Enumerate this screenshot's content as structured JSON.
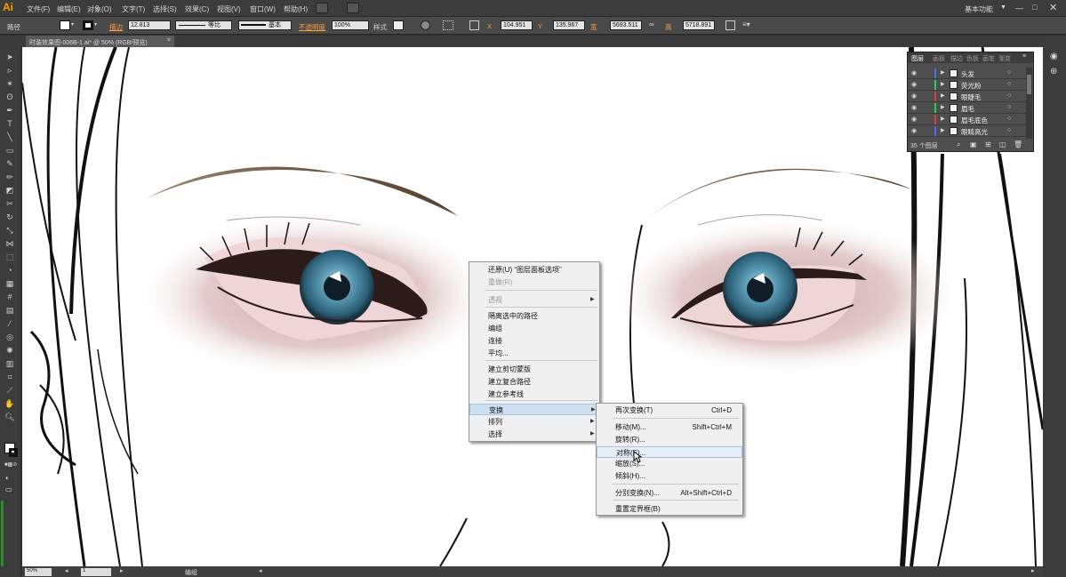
{
  "app": {
    "logo": "Ai",
    "workspace": "基本功能"
  },
  "menus": [
    "文件(F)",
    "编辑(E)",
    "对象(O)",
    "文字(T)",
    "选择(S)",
    "效果(C)",
    "视图(V)",
    "窗口(W)",
    "帮助(H)"
  ],
  "control": {
    "mode": "路径",
    "stroke_label": "描边",
    "stroke_weight": "12.813",
    "profile1": "等比",
    "profile2": "基本",
    "opacity_label": "不透明度",
    "opacity": "100%",
    "style_label": "样式",
    "x_label": "X",
    "x": "104.951",
    "y_label": "Y",
    "y": "135.967",
    "w_label": "宽",
    "w": "5693.511",
    "h_label": "高",
    "h": "5718.891"
  },
  "document": {
    "tab": "时装效果图-006B-1.ai* @ 50% (RGB/预览)",
    "zoom": "50%",
    "page": "1",
    "status": "编组"
  },
  "layers_panel": {
    "tabs": [
      "图层",
      "画板",
      "描边",
      "色板",
      "画笔",
      "渐变"
    ],
    "rows": [
      {
        "name": "头发",
        "color": "#4a6bff"
      },
      {
        "name": "荧光粉",
        "color": "#1fd64a"
      },
      {
        "name": "眼睫毛",
        "color": "#e23a3a"
      },
      {
        "name": "眉毛",
        "color": "#1fd64a"
      },
      {
        "name": "眉毛底色",
        "color": "#e23a3a"
      },
      {
        "name": "眼睛高光",
        "color": "#4a6bff"
      }
    ],
    "count": "35 个图层"
  },
  "context_menu": {
    "items": [
      {
        "label": "还原(U) “图层面板选项”",
        "disabled": false
      },
      {
        "label": "重做(R)",
        "disabled": true
      },
      {
        "label": "透视",
        "disabled": true,
        "submenu": true
      },
      {
        "label": "隔离选中的路径",
        "disabled": false
      },
      {
        "label": "编组",
        "disabled": false
      },
      {
        "label": "连接",
        "disabled": false
      },
      {
        "label": "平均...",
        "disabled": false
      },
      {
        "label": "建立剪切蒙版",
        "disabled": false
      },
      {
        "label": "建立复合路径",
        "disabled": false
      },
      {
        "label": "建立参考线",
        "disabled": false
      },
      {
        "label": "变换",
        "disabled": false,
        "submenu": true,
        "active": true
      },
      {
        "label": "排列",
        "disabled": false,
        "submenu": true
      },
      {
        "label": "选择",
        "disabled": false,
        "submenu": true
      }
    ]
  },
  "transform_submenu": {
    "items": [
      {
        "label": "再次变换(T)",
        "shortcut": "Ctrl+D"
      },
      {
        "label": "移动(M)...",
        "shortcut": "Shift+Ctrl+M"
      },
      {
        "label": "旋转(R)...",
        "shortcut": ""
      },
      {
        "label": "对称(E)...",
        "shortcut": "",
        "highlighted": true
      },
      {
        "label": "缩放(S)...",
        "shortcut": ""
      },
      {
        "label": "倾斜(H)...",
        "shortcut": ""
      },
      {
        "label": "分别变换(N)...",
        "shortcut": "Alt+Shift+Ctrl+D"
      },
      {
        "label": "重置定界框(B)",
        "shortcut": ""
      }
    ]
  },
  "colors": {
    "accent": "#ff9a00",
    "iris": "#3f7f99",
    "brow": "#6b5846"
  }
}
